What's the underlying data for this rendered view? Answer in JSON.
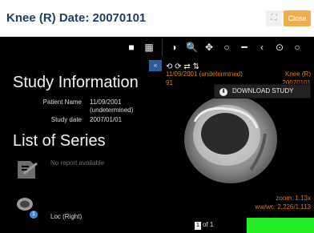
{
  "modal": {
    "title": "Knee (R) Date: 20070101",
    "expand_icon": "⛶",
    "close_label": "Close"
  },
  "toolbar": {
    "layout_single_icon": "■",
    "layout_grid_icon": "▦",
    "contrast_icon": "◑",
    "zoom_icon": "🔍",
    "pan_icon": "✥",
    "circle_icon": "○",
    "line_icon": "━",
    "prev_icon": "‹",
    "target_icon": "⊙",
    "ring_icon": "○"
  },
  "left_panel": {
    "collapse_icon": "«",
    "heading": "Study Information",
    "patient_name_label": "Patient Name",
    "patient_name_value_1": "11/09/2001",
    "patient_name_value_2": "(undetermined)",
    "study_date_label": "Study date",
    "study_date_value": "2007/01/01",
    "series_heading": "List of Series",
    "no_report": "No report available",
    "series": [
      {
        "label": "Loc (Right)",
        "count": "1"
      }
    ]
  },
  "image_panel": {
    "overlay_top_left_1": "11/09/2001 (undetermined)",
    "overlay_top_left_2": "91",
    "overlay_top_right_1": "Knee (R)",
    "overlay_top_right_2": "20070101",
    "overlay_zoom": "zoom: 1.13x",
    "overlay_wwwc": "ww/wc: 2,226/1,113",
    "download_label": "DOWNLOAD STUDY",
    "page_current": "1",
    "page_of": "of 1",
    "mini_tools": "⟲ ⟳ ⇄ ⇅"
  },
  "colors": {
    "header_text": "#1f3f60",
    "close_button": "#f0ad4e",
    "overlay_text": "#e07a1f",
    "collapse_button": "#2a5e9b",
    "badge": "#3b8de0",
    "green_bar": "#22ee22"
  }
}
